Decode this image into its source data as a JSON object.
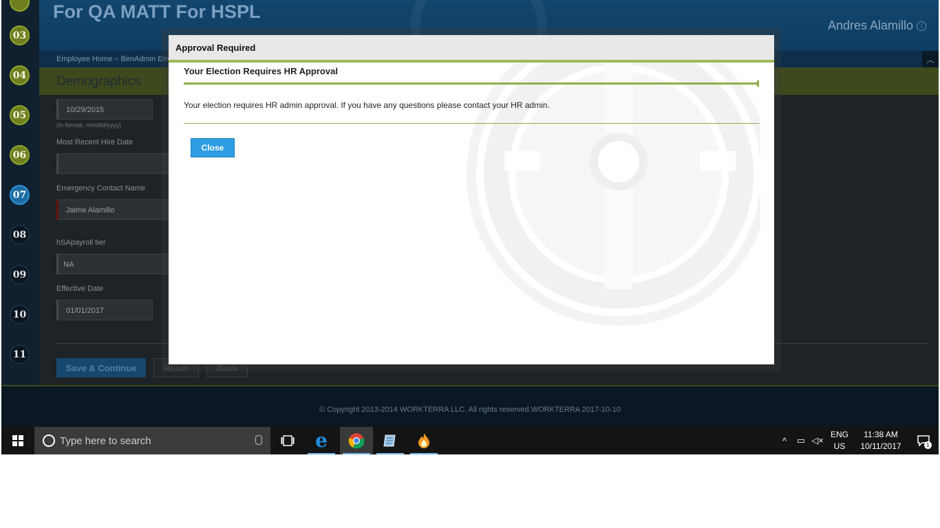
{
  "header": {
    "company": "For QA MATT For HSPL",
    "user": "Andres Alamillo"
  },
  "breadcrumb": [
    "Employee Home",
    "BenAdmin Em"
  ],
  "steps": [
    "03",
    "04",
    "05",
    "06",
    "07",
    "08",
    "09",
    "10",
    "11"
  ],
  "section": {
    "title": "Demographics"
  },
  "form": {
    "date_value": "10/29/2015",
    "date_hint": "(in format, mm/dd/yyyy)",
    "hire_label": "Most Recent Hire Date",
    "hire_value": "",
    "emergency_label": "Emergency Contact Name",
    "emergency_value": "Jaime Alamillo",
    "tier_label": "hSApayroll tier",
    "tier_value": "NA",
    "effective_label": "Effective Date",
    "effective_value": "01/01/2017",
    "save_label": "Save & Continue",
    "reset_label": "Reset",
    "back_label": "Back"
  },
  "footer": {
    "copyright": "© Copyright 2013-2014 WORKTERRA LLC. All rights reserved.WORKTERRA 2017-10-10"
  },
  "modal": {
    "title": "Approval Required",
    "subtitle": "Your Election Requires HR Approval",
    "message": "Your election requires HR admin approval. If you have any questions please contact your HR admin.",
    "close_label": "Close"
  },
  "taskbar": {
    "search_placeholder": "Type here to search",
    "lang_top": "ENG",
    "lang_bottom": "US",
    "time": "11:38 AM",
    "date": "10/11/2017",
    "notification_count": "1"
  },
  "colors": {
    "accent_green": "#9bbb59",
    "close_button": "#2e9de2",
    "current_step": "#1d6da3"
  }
}
